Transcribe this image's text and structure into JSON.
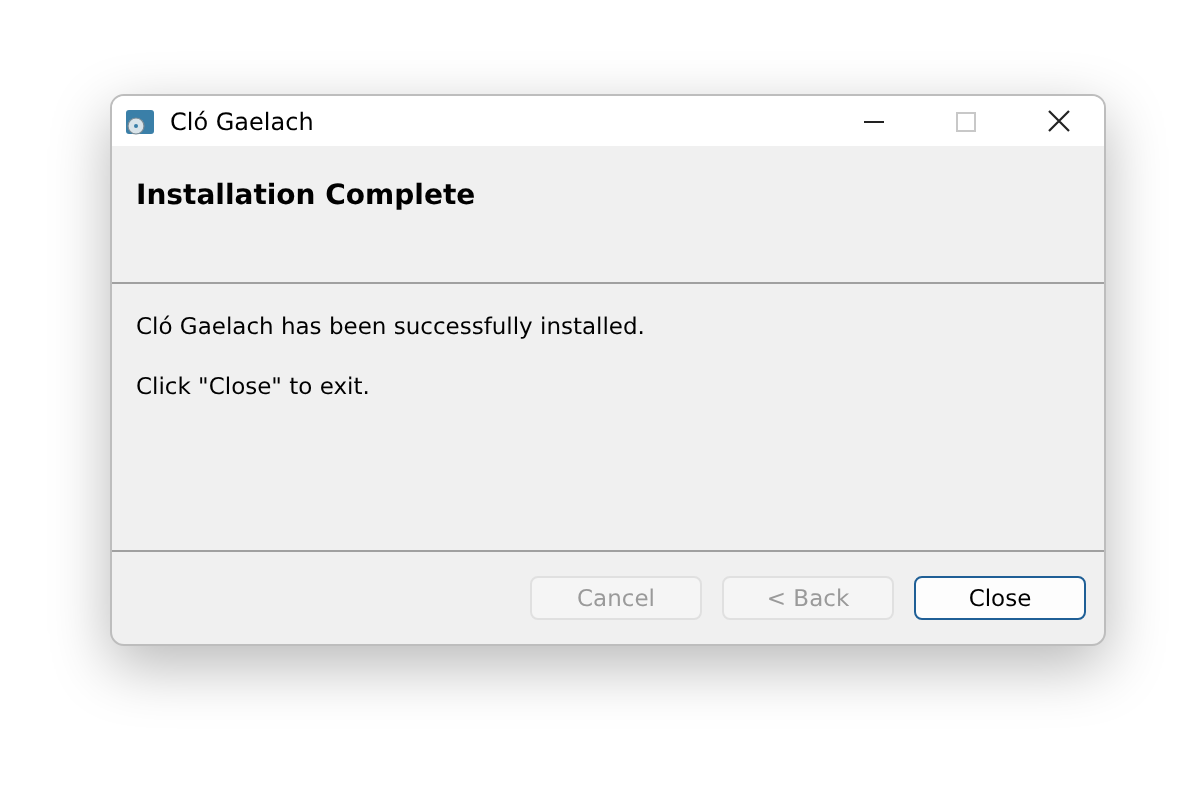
{
  "window": {
    "title": "Cló Gaelach",
    "controls": [
      {
        "kind": "minimize",
        "disabled": false
      },
      {
        "kind": "maximize",
        "disabled": true
      },
      {
        "kind": "close",
        "disabled": false
      }
    ]
  },
  "header": {
    "title": "Installation Complete"
  },
  "messages": [
    "Cló Gaelach has been successfully installed.",
    "Click \"Close\" to exit."
  ],
  "buttons": [
    {
      "label": "Cancel",
      "disabled": true,
      "default": false
    },
    {
      "label": "< Back",
      "disabled": true,
      "default": false
    },
    {
      "label": "Close",
      "disabled": false,
      "default": true
    }
  ]
}
